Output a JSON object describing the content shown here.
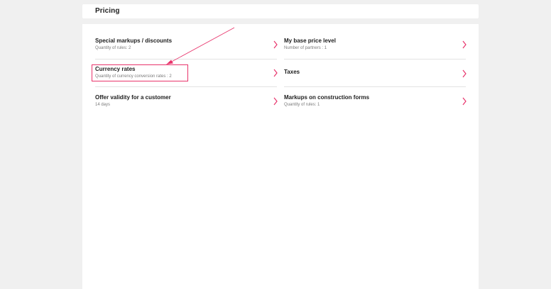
{
  "header": {
    "title": "Pricing"
  },
  "settings": {
    "left": [
      {
        "label": "Special markups / discounts",
        "sub": "Quantity of rules: 2"
      },
      {
        "label": "Currency rates",
        "sub": "Quantity of currency conversion rates : 2"
      },
      {
        "label": "Offer validity for a customer",
        "sub": "14 days"
      }
    ],
    "right": [
      {
        "label": "My base price level",
        "sub": "Number of partners : 1"
      },
      {
        "label": "Taxes",
        "sub": ""
      },
      {
        "label": "Markups on construction forms",
        "sub": "Quantity of rules: 1"
      }
    ]
  },
  "icons": {
    "item_chevron": "chevron-right-icon"
  },
  "colors": {
    "accent": "#e8336b",
    "background": "#f0f0f0",
    "card": "#ffffff"
  }
}
